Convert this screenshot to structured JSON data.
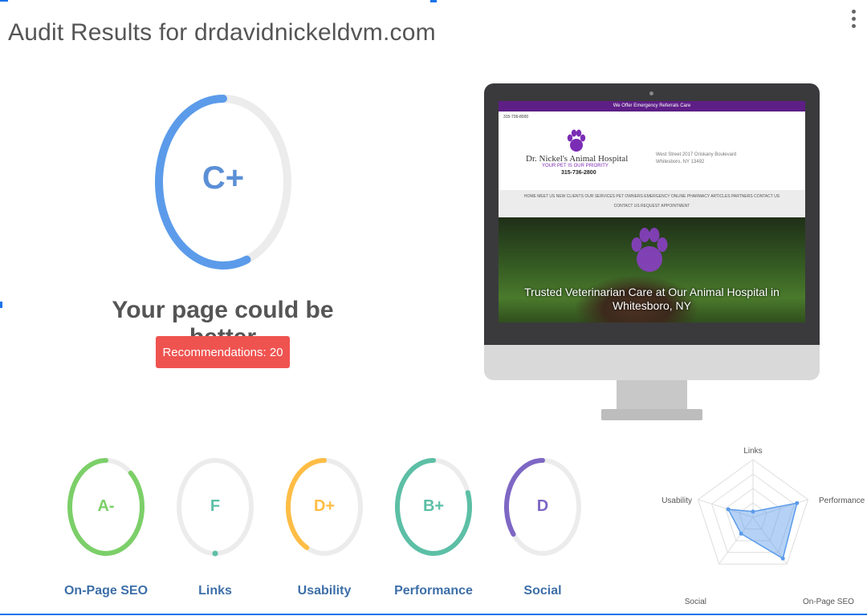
{
  "header": {
    "title": "Audit Results for drdavidnickeldvm.com",
    "menu_icon": "more-vertical-icon"
  },
  "summary": {
    "grade": "C+",
    "score": 0.56,
    "grade_color": "#5b9bea",
    "verdict": "Your page could be better",
    "recommendations_label": "Recommendations: 20",
    "recommendations_color": "#ef5350"
  },
  "preview": {
    "topbar_text": "We Offer Emergency Referrals Care",
    "phone": "315-736-8000",
    "clinic_name": "Dr. Nickel's Animal Hospital",
    "tagline": "YOUR PET IS OUR PRIORITY",
    "tel": "315-736-2800",
    "address_line1": "West Street 2017 Oriskany Boulevard",
    "address_line2": "Whitesboro, NY 13492",
    "nav_line1": "HOME  MEET US  NEW CLIENTS  OUR SERVICES  PET OWNERS  EMERGENCY  ONLINE PHARMACY  ARTICLES  PARTNERS  CONTACT US",
    "nav_line2": "CONTACT US  REQUEST APPOINTMENT",
    "hero_text": "Trusted Veterinarian Care at Our Animal Hospital in Whitesboro, NY",
    "brand_color": "#5d1e86",
    "paw_icon": "paw-icon"
  },
  "categories": [
    {
      "label": "On-Page SEO",
      "grade": "A-",
      "score": 0.88,
      "color": "#7ccf68"
    },
    {
      "label": "Links",
      "grade": "F",
      "score": 0.0,
      "color": "#5cbfa6"
    },
    {
      "label": "Usability",
      "grade": "D+",
      "score": 0.42,
      "color": "#ffbd45"
    },
    {
      "label": "Performance",
      "grade": "B+",
      "score": 0.8,
      "color": "#5cbfa6"
    },
    {
      "label": "Social",
      "grade": "D",
      "score": 0.35,
      "color": "#7e67c4"
    }
  ],
  "radar": {
    "axes": [
      "Links",
      "Performance",
      "On-Page SEO",
      "Social",
      "Usability"
    ],
    "values": [
      0.1,
      0.8,
      0.88,
      0.35,
      0.45
    ],
    "fill_color": "#5b9bea"
  }
}
